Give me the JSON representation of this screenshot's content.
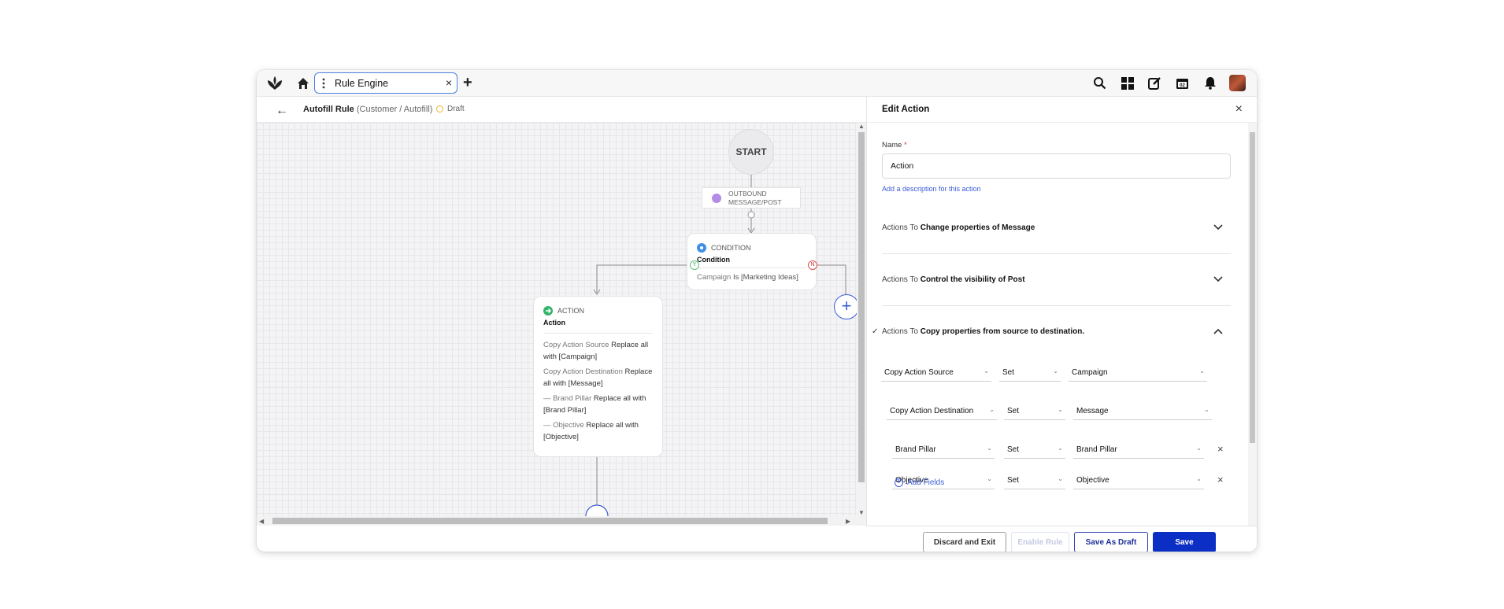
{
  "topbar": {
    "tab_label": "Rule Engine",
    "tab_close": "×",
    "new_tab": "+",
    "icons": [
      "logo-icon",
      "home-icon",
      "search-icon",
      "apps-grid-icon",
      "compose-icon",
      "calendar-icon",
      "bell-icon",
      "avatar"
    ],
    "calendar_day": "02"
  },
  "rule_header": {
    "back": "←",
    "title": "Autofill Rule",
    "subtitle": "(Customer / Autofill)",
    "status": "Draft"
  },
  "flow": {
    "start_label": "START",
    "trigger_label_1": "OUTBOUND",
    "trigger_label_2": "MESSAGE/POST",
    "condition": {
      "kind": "CONDITION",
      "name": "Condition",
      "rule_key": "Campaign",
      "rule_value": "Is [Marketing Ideas]",
      "yes": "Y",
      "no": "N"
    },
    "action": {
      "kind": "ACTION",
      "name": "Action",
      "lines": [
        {
          "key": "Copy Action Source",
          "value": "Replace all with [Campaign]"
        },
        {
          "key": "Copy Action Destination",
          "value": "Replace all with [Message]"
        },
        {
          "key": "— Brand Pillar",
          "value": "Replace all with [Brand Pillar]"
        },
        {
          "key": "— Objective",
          "value": "Replace all with [Objective]"
        }
      ]
    },
    "add_node": "+"
  },
  "edit_panel": {
    "title": "Edit Action",
    "close": "×",
    "name_label": "Name",
    "required_mark": "*",
    "name_value": "Action",
    "description_link": "Add a description for this action",
    "sections": [
      {
        "prefix": "Actions To",
        "title": "Change properties of Message",
        "chevron": "⌄"
      },
      {
        "prefix": "Actions To",
        "title": "Control the visibility of Post",
        "chevron": "⌄"
      }
    ],
    "expanded_section": {
      "check": "✓",
      "prefix": "Actions To",
      "title": "Copy properties from source to destination.",
      "chevron": "⌃"
    },
    "rows": [
      {
        "field": "Copy Action Source",
        "op": "Set",
        "value": "Campaign"
      },
      {
        "field": "Copy Action Destination",
        "op": "Set",
        "value": "Message"
      },
      {
        "field": "Brand Pillar",
        "op": "Set",
        "value": "Brand Pillar"
      },
      {
        "field": "Objective",
        "op": "Set",
        "value": "Objective"
      }
    ],
    "remove_icon": "×",
    "add_fields": "Add Fields"
  },
  "footer": {
    "discard": "Discard and Exit",
    "enable": "Enable Rule",
    "save_draft": "Save As Draft",
    "save": "Save"
  },
  "colors": {
    "primary": "#0b2ec5",
    "link": "#3b5bd6",
    "draft_ring": "#f0b429",
    "condition_icon": "#3f8fe8",
    "action_icon": "#34b36a",
    "trigger_icon": "#b48be6"
  }
}
